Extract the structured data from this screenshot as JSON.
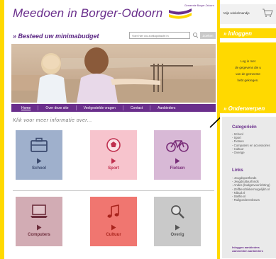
{
  "header": {
    "title": "Meedoen in Borger-Odoorn",
    "brand_small": "Gemeente Borger-Odoorn",
    "tagline": "» Besteed uw minimabudget"
  },
  "search": {
    "placeholder": "Voer hier uw zoekopdracht in",
    "button_label": "Zoeken"
  },
  "nav": {
    "items": [
      {
        "label": "Home"
      },
      {
        "label": "Over deze site"
      },
      {
        "label": "Veelgestelde vragen"
      },
      {
        "label": "Contact"
      },
      {
        "label": "Aanbieders"
      }
    ]
  },
  "main": {
    "info_text": "Klik voor meer informatie over...",
    "tiles": [
      {
        "label": "School",
        "bg": "#9fb0cc",
        "fg": "#3b4a6e",
        "icon": "briefcase-icon"
      },
      {
        "label": "Sport",
        "bg": "#f7c4cd",
        "fg": "#c0304f",
        "icon": "soccer-ball-icon"
      },
      {
        "label": "Fietsen",
        "bg": "#d8b9d6",
        "fg": "#7a2e79",
        "icon": "bicycle-icon"
      },
      {
        "label": "Computers",
        "bg": "#d2acb4",
        "fg": "#6d2e3c",
        "icon": "laptop-icon"
      },
      {
        "label": "Cultuur",
        "bg": "#f07670",
        "fg": "#a8231c",
        "icon": "music-note-icon"
      },
      {
        "label": "Overig",
        "bg": "#c9c9c9",
        "fg": "#555555",
        "icon": "magnifier-icon"
      }
    ]
  },
  "sidebar": {
    "cart_label": "Mijn winkelmandje",
    "login_heading": "» Inloggen",
    "login_note": [
      "Log in met",
      "de gegevens die u",
      "van de gemeente",
      "hebt gekregen."
    ],
    "onderwerpen_heading": "» Onderwerpen",
    "categories_title": "Categorieën",
    "categories": [
      "School",
      "Sport",
      "Fietsen",
      "Computers en accessoires",
      "Cultuur",
      "Overige"
    ],
    "links_title": "Links",
    "links": [
      "Jeugdsportfonds",
      "Jeugdcultuurfonds",
      "Andes (budgetvoorlichting)",
      "Zelfbeschikkermogelijkh.nl",
      "Nibud.nl",
      "Steffie.nl",
      "Ruilgoederenbeurs"
    ],
    "footer_links": [
      "Inloggen aanbieders",
      "Aanmelden aanbieders"
    ]
  },
  "colors": {
    "brand_purple": "#6a2f8c",
    "yellow": "#ffd900"
  }
}
